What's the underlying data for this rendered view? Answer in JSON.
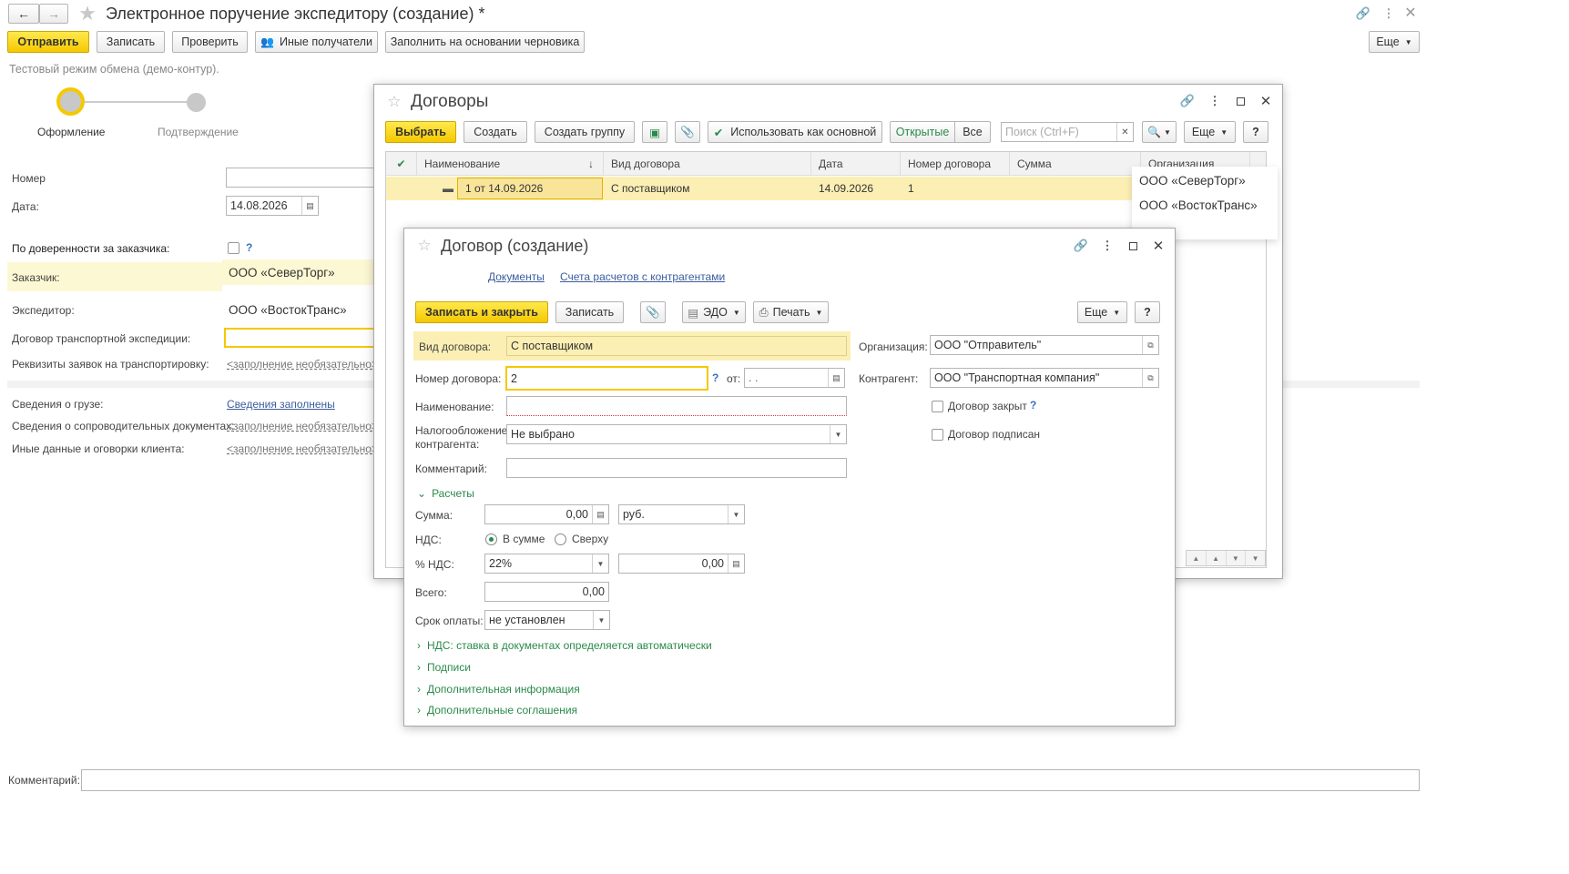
{
  "main": {
    "title": "Электронное поручение экспедитору (создание) *",
    "buttons": {
      "send": "Отправить",
      "save": "Записать",
      "check": "Проверить",
      "other_recipients": "Иные получатели",
      "fill_from_draft": "Заполнить на основании черновика",
      "more": "Еще"
    },
    "test_mode": "Тестовый режим обмена (демо-контур).",
    "steps": [
      "Оформление",
      "Подтверждение"
    ],
    "fields": {
      "number_label": "Номер",
      "date_label": "Дата:",
      "date_value": "14.08.2026",
      "proxy_label": "По доверенности за заказчика:",
      "customer_label": "Заказчик:",
      "customer_value": "ООО «СеверТорг»",
      "forwarder_label": "Экспедитор:",
      "forwarder_value": "ООО «ВостокТранс»",
      "contract_label": "Договор транспортной экспедиции:",
      "requisites_label": "Реквизиты заявок на транспортировку:",
      "requisites_value": "<заполнение необязательно>",
      "cargo_label": "Сведения о грузе:",
      "cargo_value": "Сведения заполнены",
      "accompanying_label": "Сведения о сопроводительных документах:",
      "accompanying_value": "<заполнение необязательно>",
      "other_label": "Иные данные и оговорки клиента:",
      "other_value": "<заполнение необязательно>",
      "comment_label": "Комментарий:"
    }
  },
  "contracts": {
    "title": "Договоры",
    "buttons": {
      "select": "Выбрать",
      "create": "Создать",
      "create_group": "Создать группу",
      "use_as_main": "Использовать как основной",
      "open": "Открытые",
      "all": "Все",
      "more": "Еще"
    },
    "search_placeholder": "Поиск (Ctrl+F)",
    "columns": [
      "Наименование",
      "Вид договора",
      "Дата",
      "Номер договора",
      "Сумма",
      "Организация"
    ],
    "rows": [
      {
        "name": "1 от 14.09.2026",
        "type": "С поставщиком",
        "date": "14.09.2026",
        "number": "1",
        "sum": "",
        "org": ""
      }
    ],
    "dropdown": [
      "ООО «СеверТорг»",
      "ООО «ВостокТранс»"
    ]
  },
  "contract_form": {
    "title": "Договор (создание)",
    "links": [
      "Документы",
      "Счета расчетов с контрагентами"
    ],
    "buttons": {
      "save_close": "Записать и закрыть",
      "save": "Записать",
      "edo": "ЭДО",
      "print": "Печать",
      "more": "Еще"
    },
    "fields": {
      "type_label": "Вид договора:",
      "type_value": "С поставщиком",
      "org_label": "Организация:",
      "org_value": "ООО \"Отправитель\"",
      "number_label": "Номер договора:",
      "number_value": "2",
      "from_label": "от:",
      "from_value": " .  .",
      "counterparty_label": "Контрагент:",
      "counterparty_value": "ООО \"Транспортная компания\"",
      "name_label": "Наименование:",
      "closed_label": "Договор закрыт",
      "signed_label": "Договор подписан",
      "tax_label_1": "Налогообложение",
      "tax_label_2": "контрагента:",
      "tax_value": "Не выбрано",
      "comment_label": "Комментарий:"
    },
    "calc": {
      "section": "Расчеты",
      "sum_label": "Сумма:",
      "sum_value": "0,00",
      "currency": "руб.",
      "vat_label": "НДС:",
      "vat_in": "В сумме",
      "vat_top": "Сверху",
      "vat_rate_label": "% НДС:",
      "vat_rate": "22%",
      "vat_amount": "0,00",
      "total_label": "Всего:",
      "total_value": "0,00",
      "term_label": "Срок оплаты:",
      "term_value": "не установлен"
    },
    "sections": [
      "НДС: ставка в документах определяется автоматически",
      "Подписи",
      "Дополнительная информация",
      "Дополнительные соглашения"
    ]
  }
}
